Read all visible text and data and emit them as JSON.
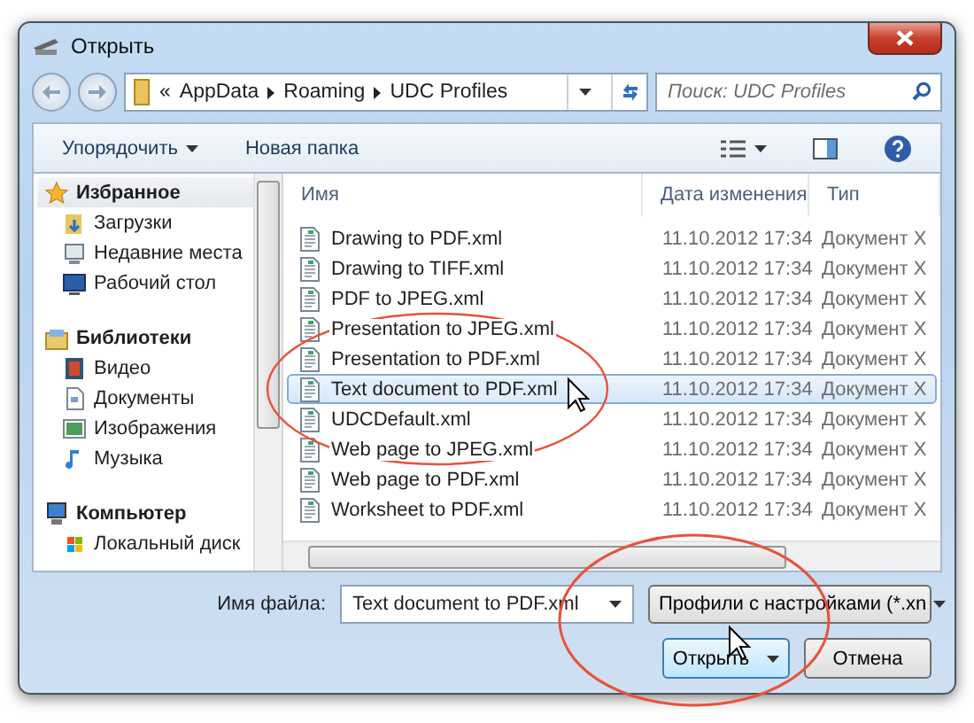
{
  "window": {
    "title": "Открыть"
  },
  "address": {
    "overflow": "«",
    "crumbs": [
      "AppData",
      "Roaming",
      "UDC Profiles"
    ]
  },
  "search": {
    "placeholder": "Поиск: UDC Profiles"
  },
  "toolbar": {
    "organize": "Упорядочить",
    "new_folder": "Новая папка"
  },
  "sidebar": {
    "groups": [
      {
        "label": "Избранное",
        "selected": true,
        "children": [
          {
            "label": "Загрузки",
            "selected": false
          },
          {
            "label": "Недавние места",
            "selected": false
          },
          {
            "label": "Рабочий стол",
            "selected": false
          }
        ]
      },
      {
        "label": "Библиотеки",
        "selected": false,
        "children": [
          {
            "label": "Видео",
            "selected": false
          },
          {
            "label": "Документы",
            "selected": false
          },
          {
            "label": "Изображения",
            "selected": false
          },
          {
            "label": "Музыка",
            "selected": false
          }
        ]
      },
      {
        "label": "Компьютер",
        "selected": false,
        "children": [
          {
            "label": "Локальный диск",
            "selected": false
          }
        ]
      }
    ]
  },
  "table": {
    "columns": [
      "Имя",
      "Дата изменения",
      "Тип"
    ],
    "rows": [
      {
        "name": "Drawing to PDF.xml",
        "date": "11.10.2012 17:34",
        "type": "Документ X",
        "selected": false
      },
      {
        "name": "Drawing to TIFF.xml",
        "date": "11.10.2012 17:34",
        "type": "Документ X",
        "selected": false
      },
      {
        "name": "PDF to JPEG.xml",
        "date": "11.10.2012 17:34",
        "type": "Документ X",
        "selected": false
      },
      {
        "name": "Presentation to JPEG.xml",
        "date": "11.10.2012 17:34",
        "type": "Документ X",
        "selected": false
      },
      {
        "name": "Presentation to PDF.xml",
        "date": "11.10.2012 17:34",
        "type": "Документ X",
        "selected": false
      },
      {
        "name": "Text document to PDF.xml",
        "date": "11.10.2012 17:34",
        "type": "Документ X",
        "selected": true
      },
      {
        "name": "UDCDefault.xml",
        "date": "11.10.2012 17:34",
        "type": "Документ X",
        "selected": false
      },
      {
        "name": "Web page to JPEG.xml",
        "date": "11.10.2012 17:34",
        "type": "Документ X",
        "selected": false
      },
      {
        "name": "Web page to PDF.xml",
        "date": "11.10.2012 17:34",
        "type": "Документ X",
        "selected": false
      },
      {
        "name": "Worksheet to PDF.xml",
        "date": "11.10.2012 17:34",
        "type": "Документ X",
        "selected": false
      }
    ]
  },
  "filename": {
    "label": "Имя файла:",
    "value": "Text document to PDF.xml"
  },
  "filetype": {
    "value": "Профили с настройками (*.xn"
  },
  "buttons": {
    "open": "Открыть",
    "cancel": "Отмена"
  }
}
